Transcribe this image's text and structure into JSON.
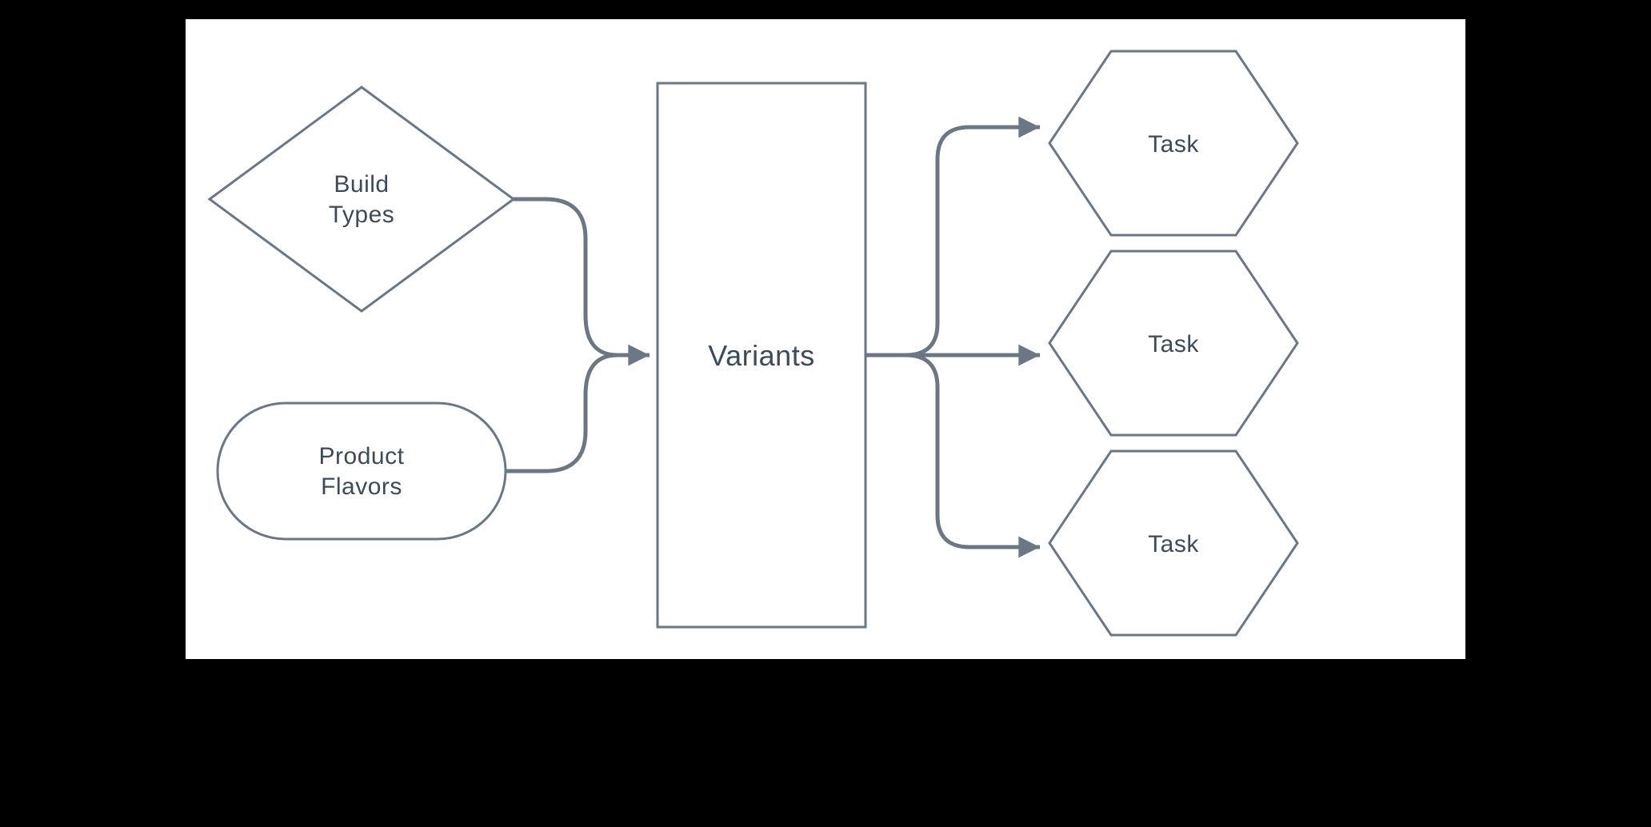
{
  "colors": {
    "stroke": "#6b7785",
    "text": "#3c4a59",
    "fill": "#ffffff"
  },
  "nodes": {
    "build_types": {
      "line1": "Build",
      "line2": "Types"
    },
    "product_flavors": {
      "line1": "Product",
      "line2": "Flavors"
    },
    "variants": {
      "label": "Variants"
    },
    "task_top": {
      "label": "Task"
    },
    "task_mid": {
      "label": "Task"
    },
    "task_bot": {
      "label": "Task"
    }
  },
  "edges": [
    {
      "from": "build_types",
      "to": "variants"
    },
    {
      "from": "product_flavors",
      "to": "variants"
    },
    {
      "from": "variants",
      "to": "task_top"
    },
    {
      "from": "variants",
      "to": "task_mid"
    },
    {
      "from": "variants",
      "to": "task_bot"
    }
  ]
}
